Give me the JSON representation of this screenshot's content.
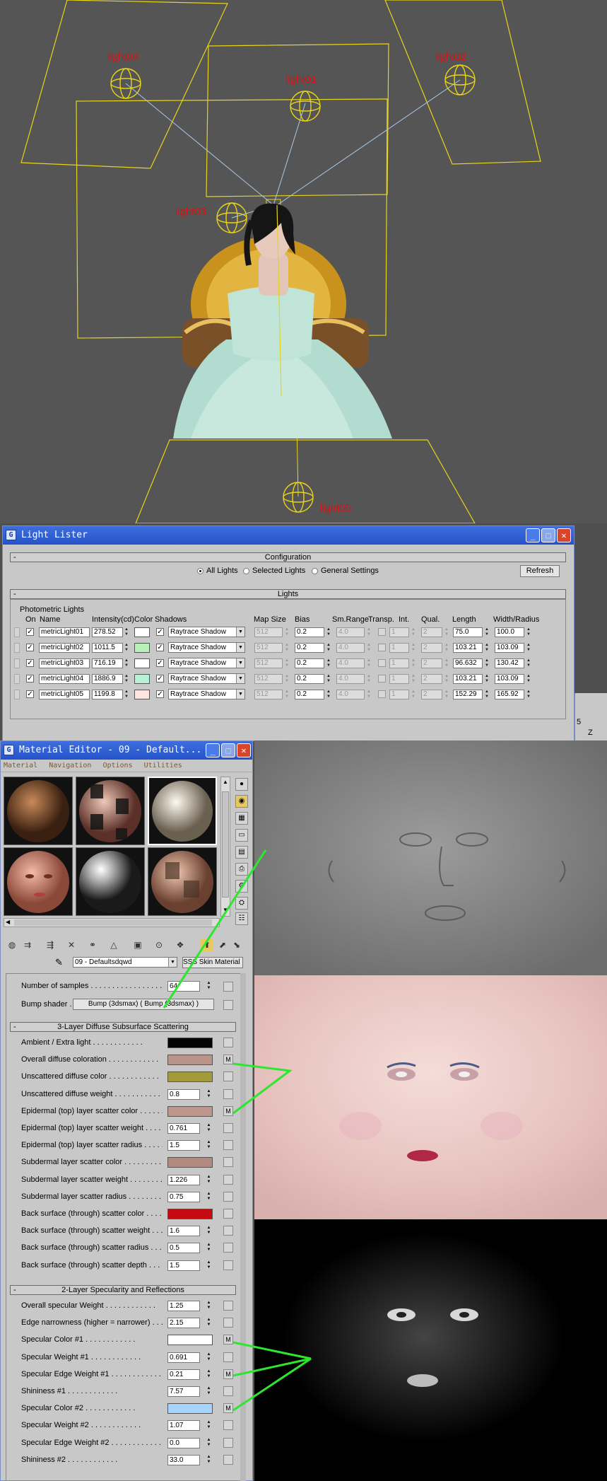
{
  "viewport": {
    "light_labels": [
      "light04",
      "light01",
      "light02",
      "light03",
      "light05"
    ],
    "right_edge_text": [
      "5",
      "Z"
    ]
  },
  "light_lister": {
    "title": "Light Lister",
    "config_header": "Configuration",
    "radios": [
      "All Lights",
      "Selected Lights",
      "General Settings"
    ],
    "selected_radio": "All Lights",
    "refresh": "Refresh",
    "lights_header": "Lights",
    "group_label": "Photometric Lights",
    "columns": {
      "on": "On",
      "name": "Name",
      "intensity": "Intensity(cd)",
      "color": "Color",
      "shadows": "Shadows",
      "map_size": "Map Size",
      "bias": "Bias",
      "sm_range": "Sm.Range",
      "transp": "Transp.",
      "int": "Int.",
      "qual": "Qual.",
      "length": "Length",
      "width": "Width/Radius"
    },
    "rows": [
      {
        "on": true,
        "name": "metricLight01",
        "intensity": "278.52",
        "color": "#ffffff",
        "shadow_on": true,
        "shadow": "Raytrace Shadow",
        "map_size": "512",
        "bias": "0.2",
        "sm_range": "4.0",
        "transp": false,
        "int": "1",
        "qual": "2",
        "length": "75.0",
        "width": "100.0"
      },
      {
        "on": true,
        "name": "metricLight02",
        "intensity": "1011.5",
        "color": "#b8f0b8",
        "shadow_on": true,
        "shadow": "Raytrace Shadow",
        "map_size": "512",
        "bias": "0.2",
        "sm_range": "4.0",
        "transp": false,
        "int": "1",
        "qual": "2",
        "length": "103.21",
        "width": "103.09"
      },
      {
        "on": true,
        "name": "metricLight03",
        "intensity": "716.19",
        "color": "#ffffff",
        "shadow_on": true,
        "shadow": "Raytrace Shadow",
        "map_size": "512",
        "bias": "0.2",
        "sm_range": "4.0",
        "transp": false,
        "int": "1",
        "qual": "2",
        "length": "96.632",
        "width": "130.42"
      },
      {
        "on": true,
        "name": "metricLight04",
        "intensity": "1886.9",
        "color": "#b8f0d8",
        "shadow_on": true,
        "shadow": "Raytrace Shadow",
        "map_size": "512",
        "bias": "0.2",
        "sm_range": "4.0",
        "transp": false,
        "int": "1",
        "qual": "2",
        "length": "103.21",
        "width": "103.09"
      },
      {
        "on": true,
        "name": "metricLight05",
        "intensity": "1199.8",
        "color": "#fde6e0",
        "shadow_on": true,
        "shadow": "Raytrace Shadow",
        "map_size": "512",
        "bias": "0.2",
        "sm_range": "4.0",
        "transp": false,
        "int": "1",
        "qual": "2",
        "length": "152.29",
        "width": "165.92"
      }
    ]
  },
  "material_editor": {
    "title": "Material Editor - 09 - Default...",
    "menu": [
      "Material",
      "Navigation",
      "Options",
      "Utilities"
    ],
    "material_name": "09 - Defaultsdqwd",
    "material_type": "SSS Skin Material (mi)",
    "samples_label": "Number of samples",
    "samples_value": "64",
    "bump_label": "Bump shader",
    "bump_value": "Bump (3dsmax) ( Bump (3dsmax) )",
    "rollout1": "3-Layer Diffuse Subsurface Scattering",
    "rollout2": "2-Layer Specularity and Reflections",
    "diffuse_params": [
      {
        "label": "Ambient / Extra light",
        "color": "#050505",
        "map": ""
      },
      {
        "label": "Overall diffuse coloration",
        "color": "#b8948a",
        "map": "M"
      },
      {
        "label": "Unscattered diffuse color",
        "color": "#a39a3c",
        "map": ""
      },
      {
        "label": "Unscattered diffuse weight",
        "value": "0.8",
        "map": ""
      },
      {
        "label": "Epidermal (top) layer scatter color",
        "color": "#c0968c",
        "map": "M"
      },
      {
        "label": "Epidermal (top) layer scatter weight",
        "value": "0.761",
        "map": ""
      },
      {
        "label": "Epidermal (top) layer scatter radius",
        "value": "1.5",
        "map": ""
      },
      {
        "label": "Subdermal layer scatter color",
        "color": "#b48a80",
        "map": ""
      },
      {
        "label": "Subdermal layer scatter weight",
        "value": "1.226",
        "map": ""
      },
      {
        "label": "Subdermal layer scatter radius",
        "value": "0.75",
        "map": ""
      },
      {
        "label": "Back surface (through) scatter color",
        "color": "#c40a10",
        "map": ""
      },
      {
        "label": "Back surface (through) scatter weight",
        "value": "1.6",
        "map": ""
      },
      {
        "label": "Back surface (through) scatter radius",
        "value": "0.5",
        "map": ""
      },
      {
        "label": "Back surface (through) scatter depth",
        "value": "1.5",
        "map": ""
      }
    ],
    "spec_params": [
      {
        "label": "Overall specular Weight",
        "value": "1.25",
        "map": ""
      },
      {
        "label": "Edge narrowness (higher = narrower)",
        "value": "2.15",
        "map": ""
      },
      {
        "label": "Specular Color #1",
        "color": "#ffffff",
        "map": "M"
      },
      {
        "label": "Specular Weight #1",
        "value": "0.691",
        "map": ""
      },
      {
        "label": "Specular Edge Weight #1",
        "value": "0.21",
        "map": "M"
      },
      {
        "label": "Shininess #1",
        "value": "7.57",
        "map": ""
      },
      {
        "label": "Specular Color #2",
        "color": "#a6d4ff",
        "map": "M"
      },
      {
        "label": "Specular Weight #2",
        "value": "1.07",
        "map": ""
      },
      {
        "label": "Specular Edge Weight #2",
        "value": "0.0",
        "map": ""
      },
      {
        "label": "Shininess #2",
        "value": "33.0",
        "map": ""
      }
    ]
  },
  "texture_panel": {
    "maps": [
      "bump-map",
      "diffuse-map",
      "specular-map"
    ],
    "connector_color": "#2ee62e"
  }
}
